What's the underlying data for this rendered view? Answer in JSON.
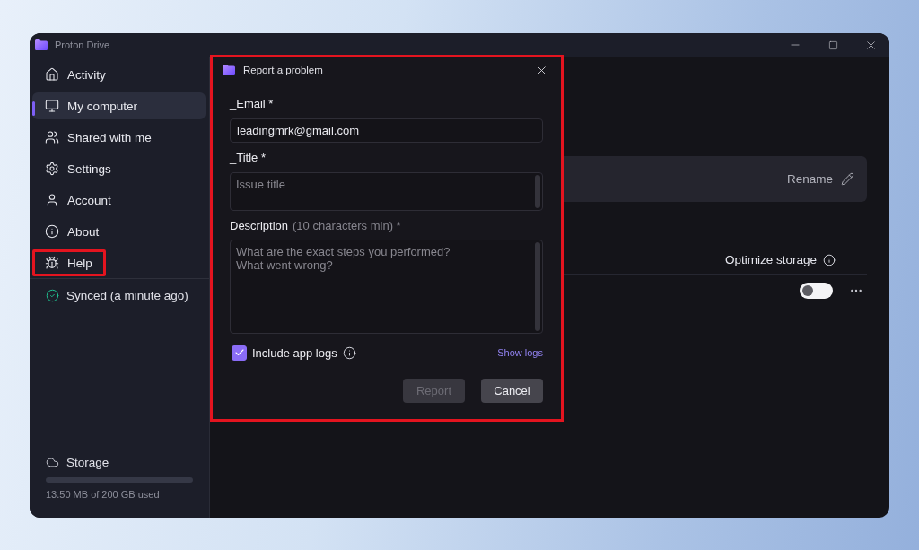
{
  "window": {
    "title": "Proton Drive"
  },
  "sidebar": {
    "items": [
      {
        "label": "Activity",
        "selected": false,
        "highlighted": false
      },
      {
        "label": "My computer",
        "selected": true,
        "highlighted": false
      },
      {
        "label": "Shared with me",
        "selected": false,
        "highlighted": false
      },
      {
        "label": "Settings",
        "selected": false,
        "highlighted": false
      },
      {
        "label": "Account",
        "selected": false,
        "highlighted": false
      },
      {
        "label": "About",
        "selected": false,
        "highlighted": false
      },
      {
        "label": "Help",
        "selected": false,
        "highlighted": true
      }
    ],
    "sync_status": "Synced (a minute ago)",
    "storage": {
      "label": "Storage",
      "usage": "13.50 MB of 200 GB used"
    }
  },
  "main": {
    "device_card": {
      "action": "Rename"
    },
    "list_header": "Optimize storage",
    "rows": [
      {
        "on": false
      }
    ]
  },
  "dialog": {
    "title": "Report a problem",
    "highlighted": true,
    "fields": [
      {
        "kind": "input",
        "label": "_Email *",
        "value": "leadingmrk@gmail.com"
      },
      {
        "kind": "textarea",
        "label": "_Title *",
        "placeholder": "Issue title"
      },
      {
        "kind": "tallarea",
        "label": "Description",
        "hint": "(10 characters min) *",
        "placeholder": "What are the exact steps you performed?\nWhat went wrong?"
      }
    ],
    "logs": {
      "label": "Include app logs",
      "checked": true,
      "link": "Show logs"
    },
    "buttons": [
      {
        "label": "Report",
        "disabled": true
      },
      {
        "label": "Cancel",
        "disabled": false
      }
    ]
  }
}
